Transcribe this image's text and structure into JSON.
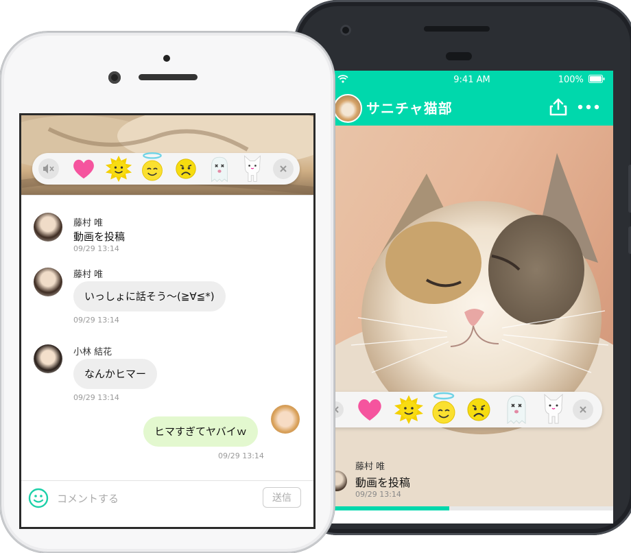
{
  "android_app": {
    "status_bar": {
      "time": "9:41 AM",
      "battery": "100%"
    },
    "header": {
      "title": "サニチャ猫部"
    },
    "video_progress": 0.42,
    "reactions": [
      "close",
      "heart",
      "sun",
      "angel",
      "scared",
      "ghost",
      "cat",
      "close"
    ],
    "message": {
      "name": "藤村 唯",
      "text": "動画を投稿",
      "time": "09/29 13:14"
    }
  },
  "iphone_app": {
    "reactions": [
      "mute",
      "heart",
      "sun",
      "angel",
      "scared",
      "ghost",
      "cat",
      "close"
    ],
    "messages": [
      {
        "name": "藤村 唯",
        "text": "動画を投稿",
        "time": "09/29 13:14",
        "style": "plain"
      },
      {
        "name": "藤村 唯",
        "text": "いっしょに話そう〜(≧∀≦*)",
        "time": "09/29 13:14",
        "style": "bubble"
      },
      {
        "name": "小林 結花",
        "text": "なんかヒマー",
        "time": "09/29 13:14",
        "style": "bubble"
      },
      {
        "name": "",
        "text": "ヒマすぎてヤバイｗ",
        "time": "09/29 13:14",
        "style": "mine"
      }
    ],
    "input": {
      "placeholder": "コメントする",
      "send_label": "送信"
    }
  },
  "colors": {
    "accent": "#00d8ac",
    "my_bubble": "#e3f8cf",
    "bubble": "#eeeeee"
  }
}
